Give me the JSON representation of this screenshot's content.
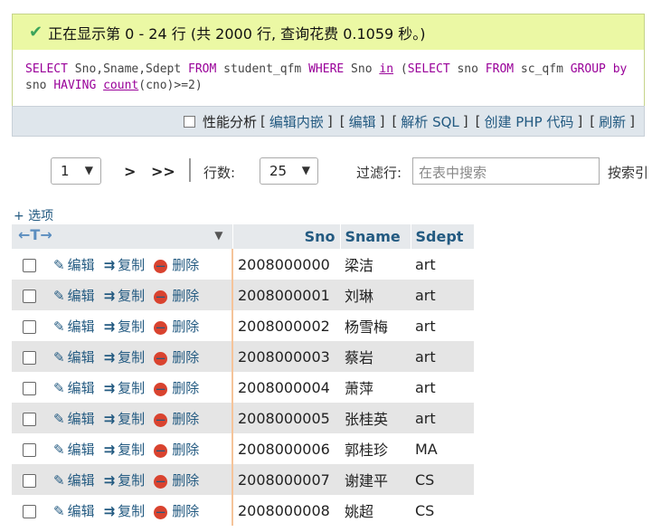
{
  "message": {
    "icon": "check-icon",
    "text": "正在显示第 0 - 24 行 (共 2000 行, 查询花费 0.1059 秒。)"
  },
  "sql": {
    "t1": "SELECT",
    "t2": " Sno,Sname,Sdept ",
    "t3": "FROM",
    "t4": " student_qfm ",
    "t5": "WHERE",
    "t6": " Sno ",
    "t7": "in",
    "t8": " (",
    "t9": "SELECT",
    "t10": " sno ",
    "t11": "FROM",
    "t12": " sc_qfm ",
    "t13": "GROUP",
    "t14": " ",
    "t15": "by",
    "t16": " sno ",
    "t17": "HAVING",
    "t18": " ",
    "t19": "count",
    "t20": "(cno)>=2)"
  },
  "actions": {
    "profiling": "性能分析",
    "inline_edit": "编辑内嵌",
    "edit": "编辑",
    "explain": "解析 SQL",
    "create_php": "创建 PHP 代码",
    "refresh": "刷新"
  },
  "nav": {
    "page_value": "1",
    "next": ">",
    "last": ">>",
    "rows_label": "行数:",
    "rows_value": "25",
    "filter_label": "过滤行:",
    "filter_placeholder": "在表中搜索",
    "search_key_label": "按索引"
  },
  "options_label": "+ 选项",
  "columns": [
    "Sno",
    "Sname",
    "Sdept"
  ],
  "row_actions": {
    "edit": "编辑",
    "copy": "复制",
    "delete": "删除"
  },
  "rows": [
    {
      "sno": "2008000000",
      "sname": "梁洁",
      "sdept": "art"
    },
    {
      "sno": "2008000001",
      "sname": "刘琳",
      "sdept": "art"
    },
    {
      "sno": "2008000002",
      "sname": "杨雪梅",
      "sdept": "art"
    },
    {
      "sno": "2008000003",
      "sname": "蔡岩",
      "sdept": "art"
    },
    {
      "sno": "2008000004",
      "sname": "萧萍",
      "sdept": "art"
    },
    {
      "sno": "2008000005",
      "sname": "张桂英",
      "sdept": "art"
    },
    {
      "sno": "2008000006",
      "sname": "郭桂珍",
      "sdept": "MA"
    },
    {
      "sno": "2008000007",
      "sname": "谢建平",
      "sdept": "CS"
    },
    {
      "sno": "2008000008",
      "sname": "姚超",
      "sdept": "CS"
    }
  ],
  "colors": {
    "success_bg": "#ebf8a4",
    "link": "#235a81",
    "keyword": "#990099",
    "row_alt": "#e5e5e5"
  }
}
